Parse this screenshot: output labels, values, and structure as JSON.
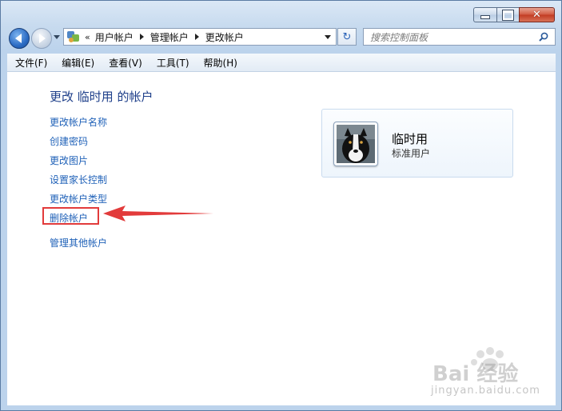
{
  "window": {
    "caption": {
      "minimize_icon": "minimize-icon",
      "maximize_icon": "maximize-icon",
      "close_glyph": "✕"
    }
  },
  "nav": {
    "chevrons": "«",
    "breadcrumbs": [
      "用户帐户",
      "管理帐户",
      "更改帐户"
    ],
    "search_placeholder": "搜索控制面板",
    "refresh_glyph": "↻"
  },
  "menu": {
    "items": [
      "文件(F)",
      "编辑(E)",
      "查看(V)",
      "工具(T)",
      "帮助(H)"
    ]
  },
  "content": {
    "title": "更改 临时用 的帐户",
    "links": [
      "更改帐户名称",
      "创建密码",
      "更改图片",
      "设置家长控制",
      "更改帐户类型",
      "删除帐户",
      "管理其他帐户"
    ],
    "highlight_color": "#e23b3b"
  },
  "user": {
    "name": "临时用",
    "type": "标准用户"
  },
  "watermark": {
    "line1": "Bai 经验",
    "line2": "jingyan.baidu.com"
  }
}
